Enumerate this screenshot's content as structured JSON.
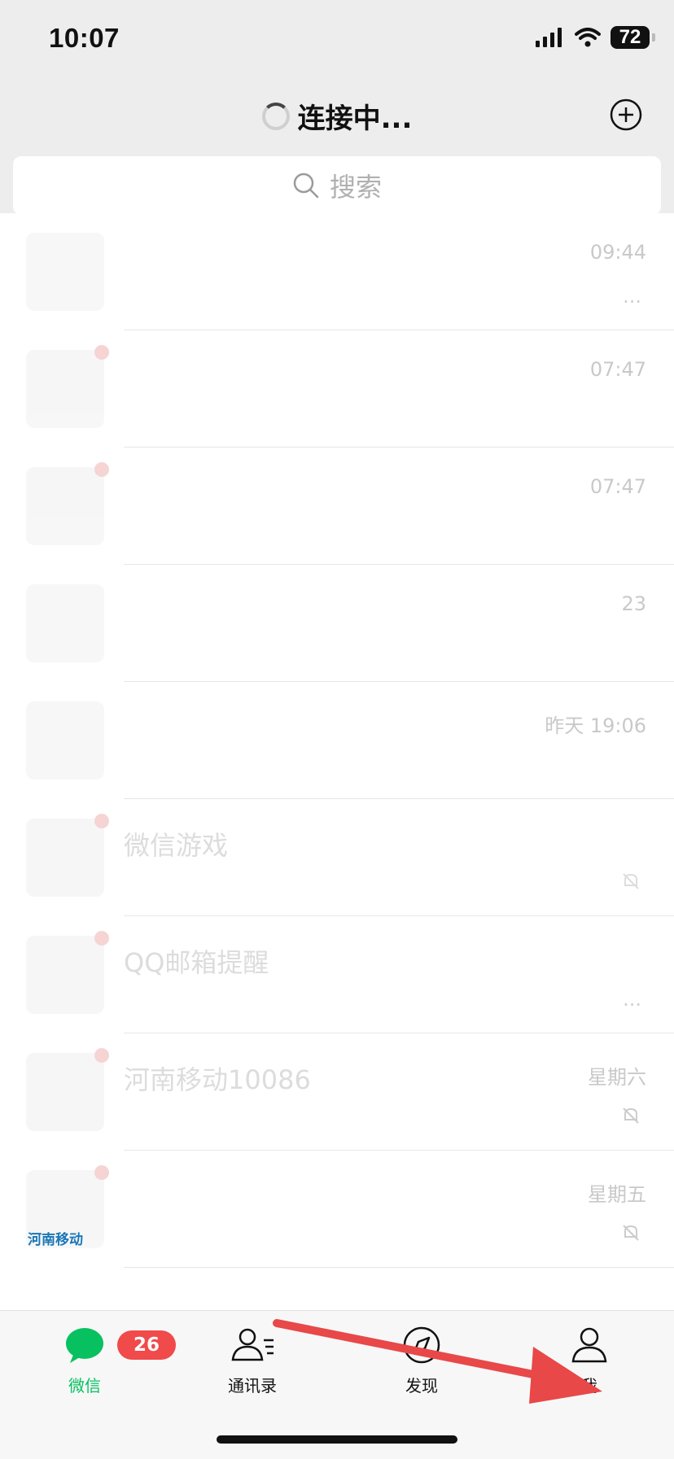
{
  "status_bar": {
    "time": "10:07",
    "battery": "72"
  },
  "header": {
    "title": "连接中..."
  },
  "search": {
    "placeholder": "搜索"
  },
  "chats": [
    {
      "name": "",
      "preview": "",
      "time": "09:44",
      "extra": "..."
    },
    {
      "name": "",
      "preview": "",
      "time": "07:47",
      "extra": ""
    },
    {
      "name": "",
      "preview": "",
      "time": "07:47",
      "extra": ""
    },
    {
      "name": "",
      "preview": "",
      "time": "23",
      "extra": ""
    },
    {
      "name": "",
      "preview": "",
      "time": "昨天 19:06",
      "extra": ""
    },
    {
      "name": "微信游戏",
      "preview": "",
      "time": "",
      "extra": "muted"
    },
    {
      "name": "QQ邮箱提醒",
      "preview": "",
      "time": "",
      "extra": "..."
    },
    {
      "name": "河南移动10086",
      "preview": "",
      "time": "星期六",
      "extra": "muted"
    },
    {
      "name": "",
      "preview": "",
      "time": "星期五",
      "extra": "muted",
      "logo": "河南移动"
    }
  ],
  "tabs": [
    {
      "label": "微信",
      "badge": "26",
      "icon": "chat-bubble-icon"
    },
    {
      "label": "通讯录",
      "icon": "contacts-icon"
    },
    {
      "label": "发现",
      "icon": "compass-icon"
    },
    {
      "label": "我",
      "icon": "person-icon"
    }
  ],
  "colors": {
    "accent": "#07c160",
    "badge": "#f04a4a",
    "arrow": "#e84848"
  }
}
